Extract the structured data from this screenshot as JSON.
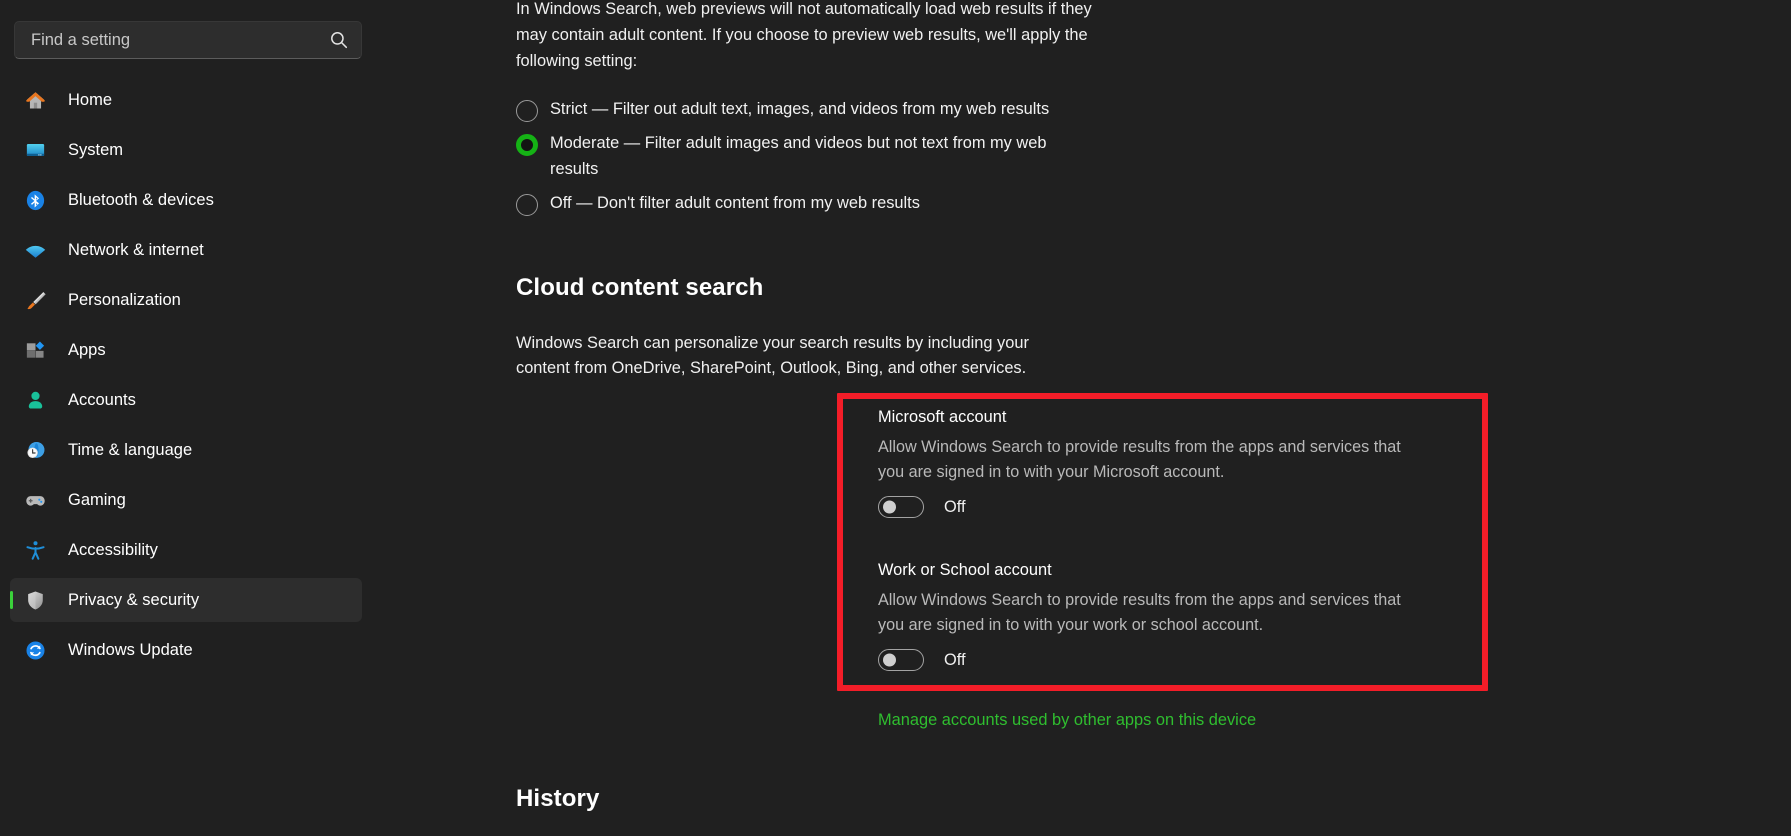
{
  "search": {
    "placeholder": "Find a setting",
    "value": "",
    "icon": "search-icon"
  },
  "sidebar": {
    "items": [
      {
        "label": "Home",
        "icon": "home-icon",
        "selected": false
      },
      {
        "label": "System",
        "icon": "system-icon",
        "selected": false
      },
      {
        "label": "Bluetooth & devices",
        "icon": "bluetooth-icon",
        "selected": false
      },
      {
        "label": "Network & internet",
        "icon": "wifi-icon",
        "selected": false
      },
      {
        "label": "Personalization",
        "icon": "paintbrush-icon",
        "selected": false
      },
      {
        "label": "Apps",
        "icon": "apps-icon",
        "selected": false
      },
      {
        "label": "Accounts",
        "icon": "person-icon",
        "selected": false
      },
      {
        "label": "Time & language",
        "icon": "clock-globe-icon",
        "selected": false
      },
      {
        "label": "Gaming",
        "icon": "gamepad-icon",
        "selected": false
      },
      {
        "label": "Accessibility",
        "icon": "accessibility-icon",
        "selected": false
      },
      {
        "label": "Privacy & security",
        "icon": "shield-icon",
        "selected": true
      },
      {
        "label": "Windows Update",
        "icon": "update-refresh-icon",
        "selected": false
      }
    ]
  },
  "main": {
    "intro_paragraph": "In Windows Search, web previews will not automatically load web results if they may contain adult content. If you choose to preview web results, we'll apply the following setting:",
    "safe_search": {
      "options": [
        {
          "label": "Strict — Filter out adult text, images, and videos from my web results",
          "checked": false
        },
        {
          "label": "Moderate — Filter adult images and videos but not text from my web results",
          "checked": true
        },
        {
          "label": "Off — Don't filter adult content from my web results",
          "checked": false
        }
      ]
    },
    "cloud_content_search": {
      "heading": "Cloud content search",
      "description": "Windows Search can personalize your search results by including your content from OneDrive, SharePoint, Outlook, Bing, and other services.",
      "settings": [
        {
          "title": "Microsoft account",
          "description": "Allow Windows Search to provide results from the apps and services that you are signed in to with your Microsoft account.",
          "toggle_state": "Off",
          "toggle_on": false
        },
        {
          "title": "Work or School account",
          "description": "Allow Windows Search to provide results from the apps and services that you are signed in to with your work or school account.",
          "toggle_state": "Off",
          "toggle_on": false
        }
      ],
      "manage_link": "Manage accounts used by other apps on this device"
    },
    "history": {
      "heading": "History"
    }
  },
  "colors": {
    "page_background": "#202020",
    "selected_nav_background": "#2d2d2d",
    "accent_green": "#3bd13b",
    "link_green": "#2fbe2f",
    "highlight_red": "#f31d28",
    "radio_checked_green": "#15b215"
  }
}
